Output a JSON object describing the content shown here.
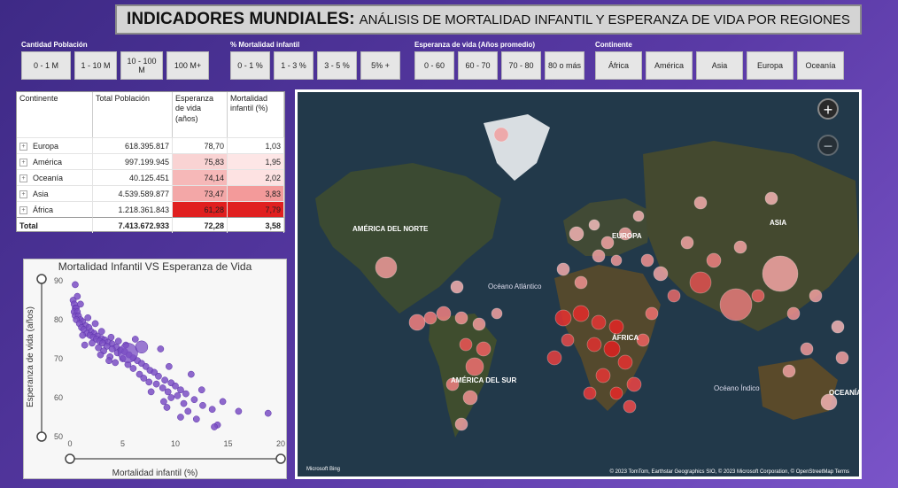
{
  "title": {
    "main": "INDICADORES MUNDIALES:",
    "sub": "ANÁLISIS DE MORTALIDAD INFANTIL Y ESPERANZA DE VIDA POR REGIONES"
  },
  "slicers": [
    {
      "label": "Cantidad Población",
      "options": [
        "0 - 1 M",
        "1 - 10 M",
        "10 - 100 M",
        "100 M+"
      ]
    },
    {
      "label": "% Mortalidad infantil",
      "options": [
        "0 - 1 %",
        "1 - 3 %",
        "3 - 5 %",
        "5% +"
      ]
    },
    {
      "label": "Esperanza de vida (Años promedio)",
      "options": [
        "0 - 60",
        "60 - 70",
        "70 - 80",
        "80 o más"
      ]
    },
    {
      "label": "Continente",
      "options": [
        "África",
        "América",
        "Asia",
        "Europa",
        "Oceanía"
      ]
    }
  ],
  "table": {
    "headers": [
      "Continente",
      "Total Población",
      "Esperanza de vida (años)",
      "Mortalidad infantil (%)"
    ],
    "rows": [
      {
        "continent": "Europa",
        "population": "618.395.817",
        "life": "78,70",
        "mortality": "1,03",
        "life_bg": "#ffffff",
        "mort_bg": "#ffffff"
      },
      {
        "continent": "América",
        "population": "997.199.945",
        "life": "75,83",
        "mortality": "1,95",
        "life_bg": "#f9d3d3",
        "mort_bg": "#fde6e6"
      },
      {
        "continent": "Oceanía",
        "population": "40.125.451",
        "life": "74,14",
        "mortality": "2,02",
        "life_bg": "#f6b8b8",
        "mort_bg": "#fde2e2"
      },
      {
        "continent": "Asia",
        "population": "4.539.589.877",
        "life": "73,47",
        "mortality": "3,83",
        "life_bg": "#f3a7a7",
        "mort_bg": "#f39a9a"
      },
      {
        "continent": "África",
        "population": "1.218.361.843",
        "life": "61,28",
        "mortality": "7,79",
        "life_bg": "#e02020",
        "mort_bg": "#e02020"
      }
    ],
    "total": {
      "label": "Total",
      "population": "7.413.672.933",
      "life": "72,28",
      "mortality": "3,58"
    }
  },
  "map": {
    "labels": {
      "na": "AMÉRICA DEL NORTE",
      "europe": "EUROPA",
      "asia": "ASIA",
      "atlantic": "Océano Atlántico",
      "africa": "ÁFRICA",
      "sa": "AMÉRICA DEL SUR",
      "indian": "Océano Índico",
      "oceania": "OCEANÍA"
    },
    "logo": "Microsoft Bing",
    "attribution": "© 2023 TomTom, Earthstar Geographics SIO, © 2023 Microsoft Corporation, © OpenStreetMap  Terms",
    "zoom_in": "+",
    "zoom_out": "−"
  },
  "chart_data": {
    "type": "scatter",
    "title": "Mortalidad Infantil VS Esperanza de Vida",
    "xlabel": "Mortalidad infantil (%)",
    "ylabel": "Esperanza de vida (años)",
    "xlim": [
      0,
      20
    ],
    "ylim": [
      50,
      90
    ],
    "xticks": [
      0,
      5,
      10,
      15,
      20
    ],
    "yticks": [
      50,
      60,
      70,
      80,
      90
    ],
    "color": "#7b4fc4",
    "points": [
      [
        0.5,
        89
      ],
      [
        0.3,
        85
      ],
      [
        0.4,
        84
      ],
      [
        0.5,
        83
      ],
      [
        0.6,
        83
      ],
      [
        0.4,
        82
      ],
      [
        0.7,
        82
      ],
      [
        0.5,
        81
      ],
      [
        0.8,
        81
      ],
      [
        1.0,
        80
      ],
      [
        0.6,
        80
      ],
      [
        1.2,
        79.5
      ],
      [
        0.9,
        79
      ],
      [
        1.5,
        78.5
      ],
      [
        1.1,
        78
      ],
      [
        1.8,
        78
      ],
      [
        1.3,
        77.5
      ],
      [
        2.0,
        77
      ],
      [
        1.6,
        76.5
      ],
      [
        2.3,
        76.5
      ],
      [
        1.9,
        76
      ],
      [
        2.6,
        75.8
      ],
      [
        2.2,
        75.5
      ],
      [
        3.0,
        75.2
      ],
      [
        2.5,
        75
      ],
      [
        3.3,
        74.8
      ],
      [
        2.8,
        74.5
      ],
      [
        3.6,
        74.2
      ],
      [
        3.1,
        74
      ],
      [
        4.0,
        73.8
      ],
      [
        1.4,
        73.5
      ],
      [
        3.5,
        73.2
      ],
      [
        4.4,
        73
      ],
      [
        2.7,
        72.8
      ],
      [
        4.0,
        72.5
      ],
      [
        4.8,
        72.2
      ],
      [
        3.2,
        72
      ],
      [
        5.2,
        71.8
      ],
      [
        4.5,
        71.5
      ],
      [
        5.6,
        71
      ],
      [
        3.8,
        70.5
      ],
      [
        6.0,
        70.2
      ],
      [
        5.0,
        70
      ],
      [
        6.4,
        69.5
      ],
      [
        4.3,
        69
      ],
      [
        6.8,
        68.8
      ],
      [
        5.5,
        68.5
      ],
      [
        7.2,
        68
      ],
      [
        6.0,
        67.5
      ],
      [
        7.6,
        67
      ],
      [
        8.0,
        66.5
      ],
      [
        6.6,
        66
      ],
      [
        8.4,
        65.5
      ],
      [
        7.0,
        65
      ],
      [
        9.0,
        64.5
      ],
      [
        7.5,
        64
      ],
      [
        9.6,
        63.8
      ],
      [
        8.2,
        63.5
      ],
      [
        10.0,
        63
      ],
      [
        8.8,
        62.5
      ],
      [
        10.5,
        62
      ],
      [
        9.3,
        61.5
      ],
      [
        11.0,
        61
      ],
      [
        10.2,
        60.5
      ],
      [
        9.6,
        60
      ],
      [
        11.8,
        59.5
      ],
      [
        10.8,
        58.5
      ],
      [
        12.6,
        58
      ],
      [
        9.2,
        57.5
      ],
      [
        13.5,
        57
      ],
      [
        11.2,
        56.5
      ],
      [
        18.8,
        56
      ],
      [
        10.5,
        55
      ],
      [
        12.0,
        54.5
      ],
      [
        14.0,
        53
      ],
      [
        13.7,
        52.5
      ],
      [
        8.6,
        72.5
      ],
      [
        9.4,
        68
      ],
      [
        11.5,
        66
      ],
      [
        12.5,
        62
      ],
      [
        14.5,
        59
      ],
      [
        16.0,
        56.5
      ],
      [
        7.7,
        61.5
      ],
      [
        8.9,
        59
      ],
      [
        2.9,
        71
      ],
      [
        3.7,
        69.5
      ],
      [
        0.7,
        86
      ],
      [
        1.0,
        84
      ],
      [
        1.7,
        80.5
      ],
      [
        2.4,
        79
      ],
      [
        3.0,
        77
      ],
      [
        3.9,
        75.5
      ],
      [
        4.6,
        74.5
      ],
      [
        5.3,
        73.5
      ],
      [
        1.2,
        76
      ],
      [
        2.1,
        74
      ],
      [
        6.2,
        75
      ]
    ],
    "bubbles": [
      [
        5.5,
        71.5
      ],
      [
        6.8,
        73
      ]
    ]
  }
}
